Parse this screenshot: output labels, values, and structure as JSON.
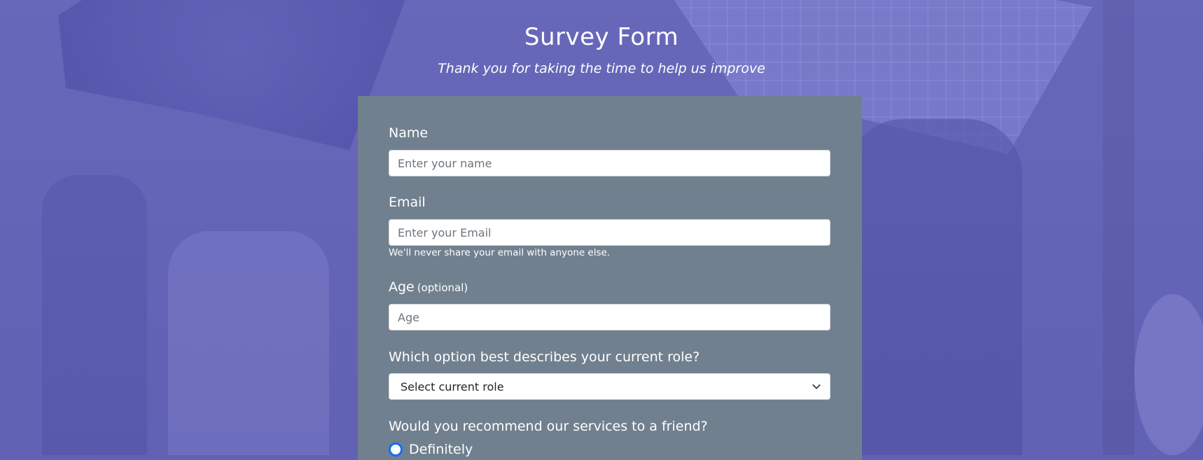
{
  "header": {
    "title": "Survey Form",
    "subtitle": "Thank you for taking the time to help us improve"
  },
  "form": {
    "name": {
      "label": "Name",
      "placeholder": "Enter your name"
    },
    "email": {
      "label": "Email",
      "placeholder": "Enter your Email",
      "help": "We'll never share your email with anyone else."
    },
    "age": {
      "label": "Age",
      "optional": "(optional)",
      "placeholder": "Age"
    },
    "role": {
      "label": "Which option best describes your current role?",
      "selected": "Select current role"
    },
    "recommend": {
      "label": "Would you recommend our services to a friend?",
      "options": [
        "Definitely"
      ]
    }
  },
  "colors": {
    "background_tint": "#6262b4",
    "card": "#71808f",
    "radio_accent": "#0d6efd"
  }
}
